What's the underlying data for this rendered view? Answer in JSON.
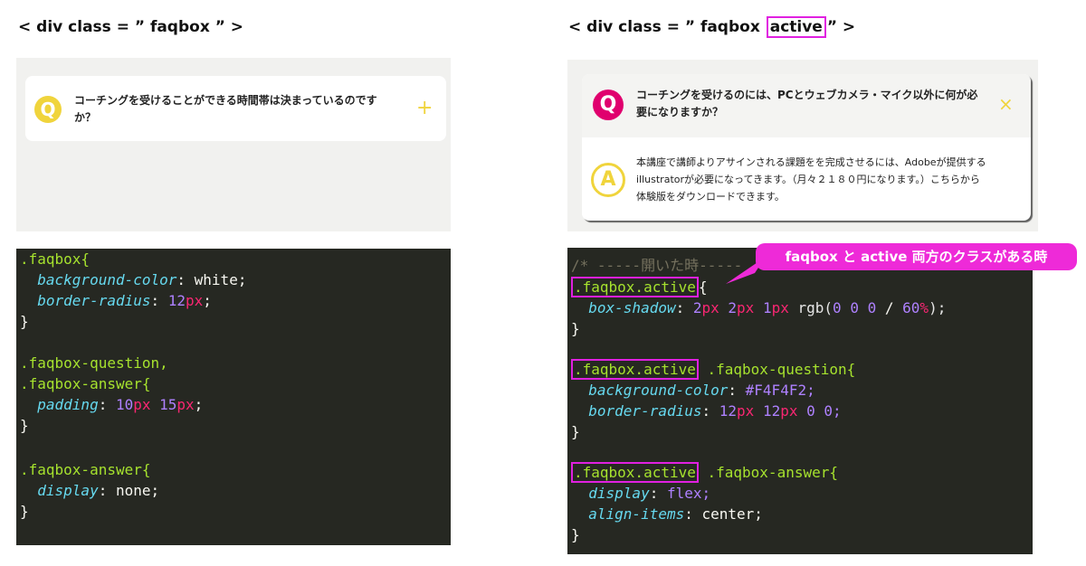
{
  "left": {
    "heading": "< div class = ” faqbox ”  >",
    "question_text": "コーチングを受けることができる時間帯は決まっているのですか？",
    "q_letter": "Q",
    "toggle_symbol": "+",
    "code": {
      "l1_sel": ".faqbox{",
      "l2_prop": "background-color",
      "l2_val": "white;",
      "l3_prop": "border-radius",
      "l3_num": "12",
      "l3_unit": "px",
      "l4": "}",
      "l6": ".faqbox-question,",
      "l7": ".faqbox-answer{",
      "l8_prop": "padding",
      "l8_num1": "10",
      "l8_unit1": "px",
      "l8_num2": "15",
      "l8_unit2": "px",
      "l9": "}",
      "l11": ".faqbox-answer{",
      "l12_prop": "display",
      "l12_val": "none;",
      "l13": "}"
    }
  },
  "right": {
    "heading_before": "< div class = ” faqbox ",
    "heading_active": "active",
    "heading_after": "”  >",
    "question_text": "コーチングを受けるのには、PCとウェブカメラ・マイク以外に何が必要になりますか？",
    "answer_text": "本講座で講師よりアサインされる課題をを完成させるには、Adobeが提供するillustratorが必要になってきます。（月々２１８０円になります。）こちらから体験版をダウンロードできます。",
    "q_letter": "Q",
    "a_letter": "A",
    "close_symbol": "×",
    "callout": "faqbox と active 両方のクラスがある時",
    "code": {
      "comment": "/* -----開いた時-----",
      "sel_active": ".faqbox.active",
      "brace": "{",
      "l2_prop": "box-shadow",
      "l2_n1": "2",
      "l2_u1": "px",
      "l2_n2": "2",
      "l2_u2": "px",
      "l2_n3": "1",
      "l2_u3": "px",
      "l2_fn": "rgb(",
      "l2_r": "0",
      "l2_g": "0",
      "l2_b": "0",
      "l2_slash": "/",
      "l2_a": "60",
      "l2_pct": "%",
      "l2_end": ");",
      "close": "}",
      "sel_q": ".faqbox-question{",
      "l6_prop": "background-color",
      "l6_val": "#F4F4F2;",
      "l7_prop": "border-radius",
      "l7_n1": "12",
      "l7_u1": "px",
      "l7_n2": "12",
      "l7_u2": "px",
      "l7_n3": "0",
      "l7_n4": "0;",
      "sel_a": ".faqbox-answer{",
      "l10_prop": "display",
      "l10_val": "flex;",
      "l11_prop": "align-items",
      "l11_val": "center;"
    }
  },
  "colors": {
    "q_yellow": "#f0d43c",
    "q_pink": "#e0006e",
    "highlight": "#e020e0",
    "code_bg": "#262822"
  }
}
